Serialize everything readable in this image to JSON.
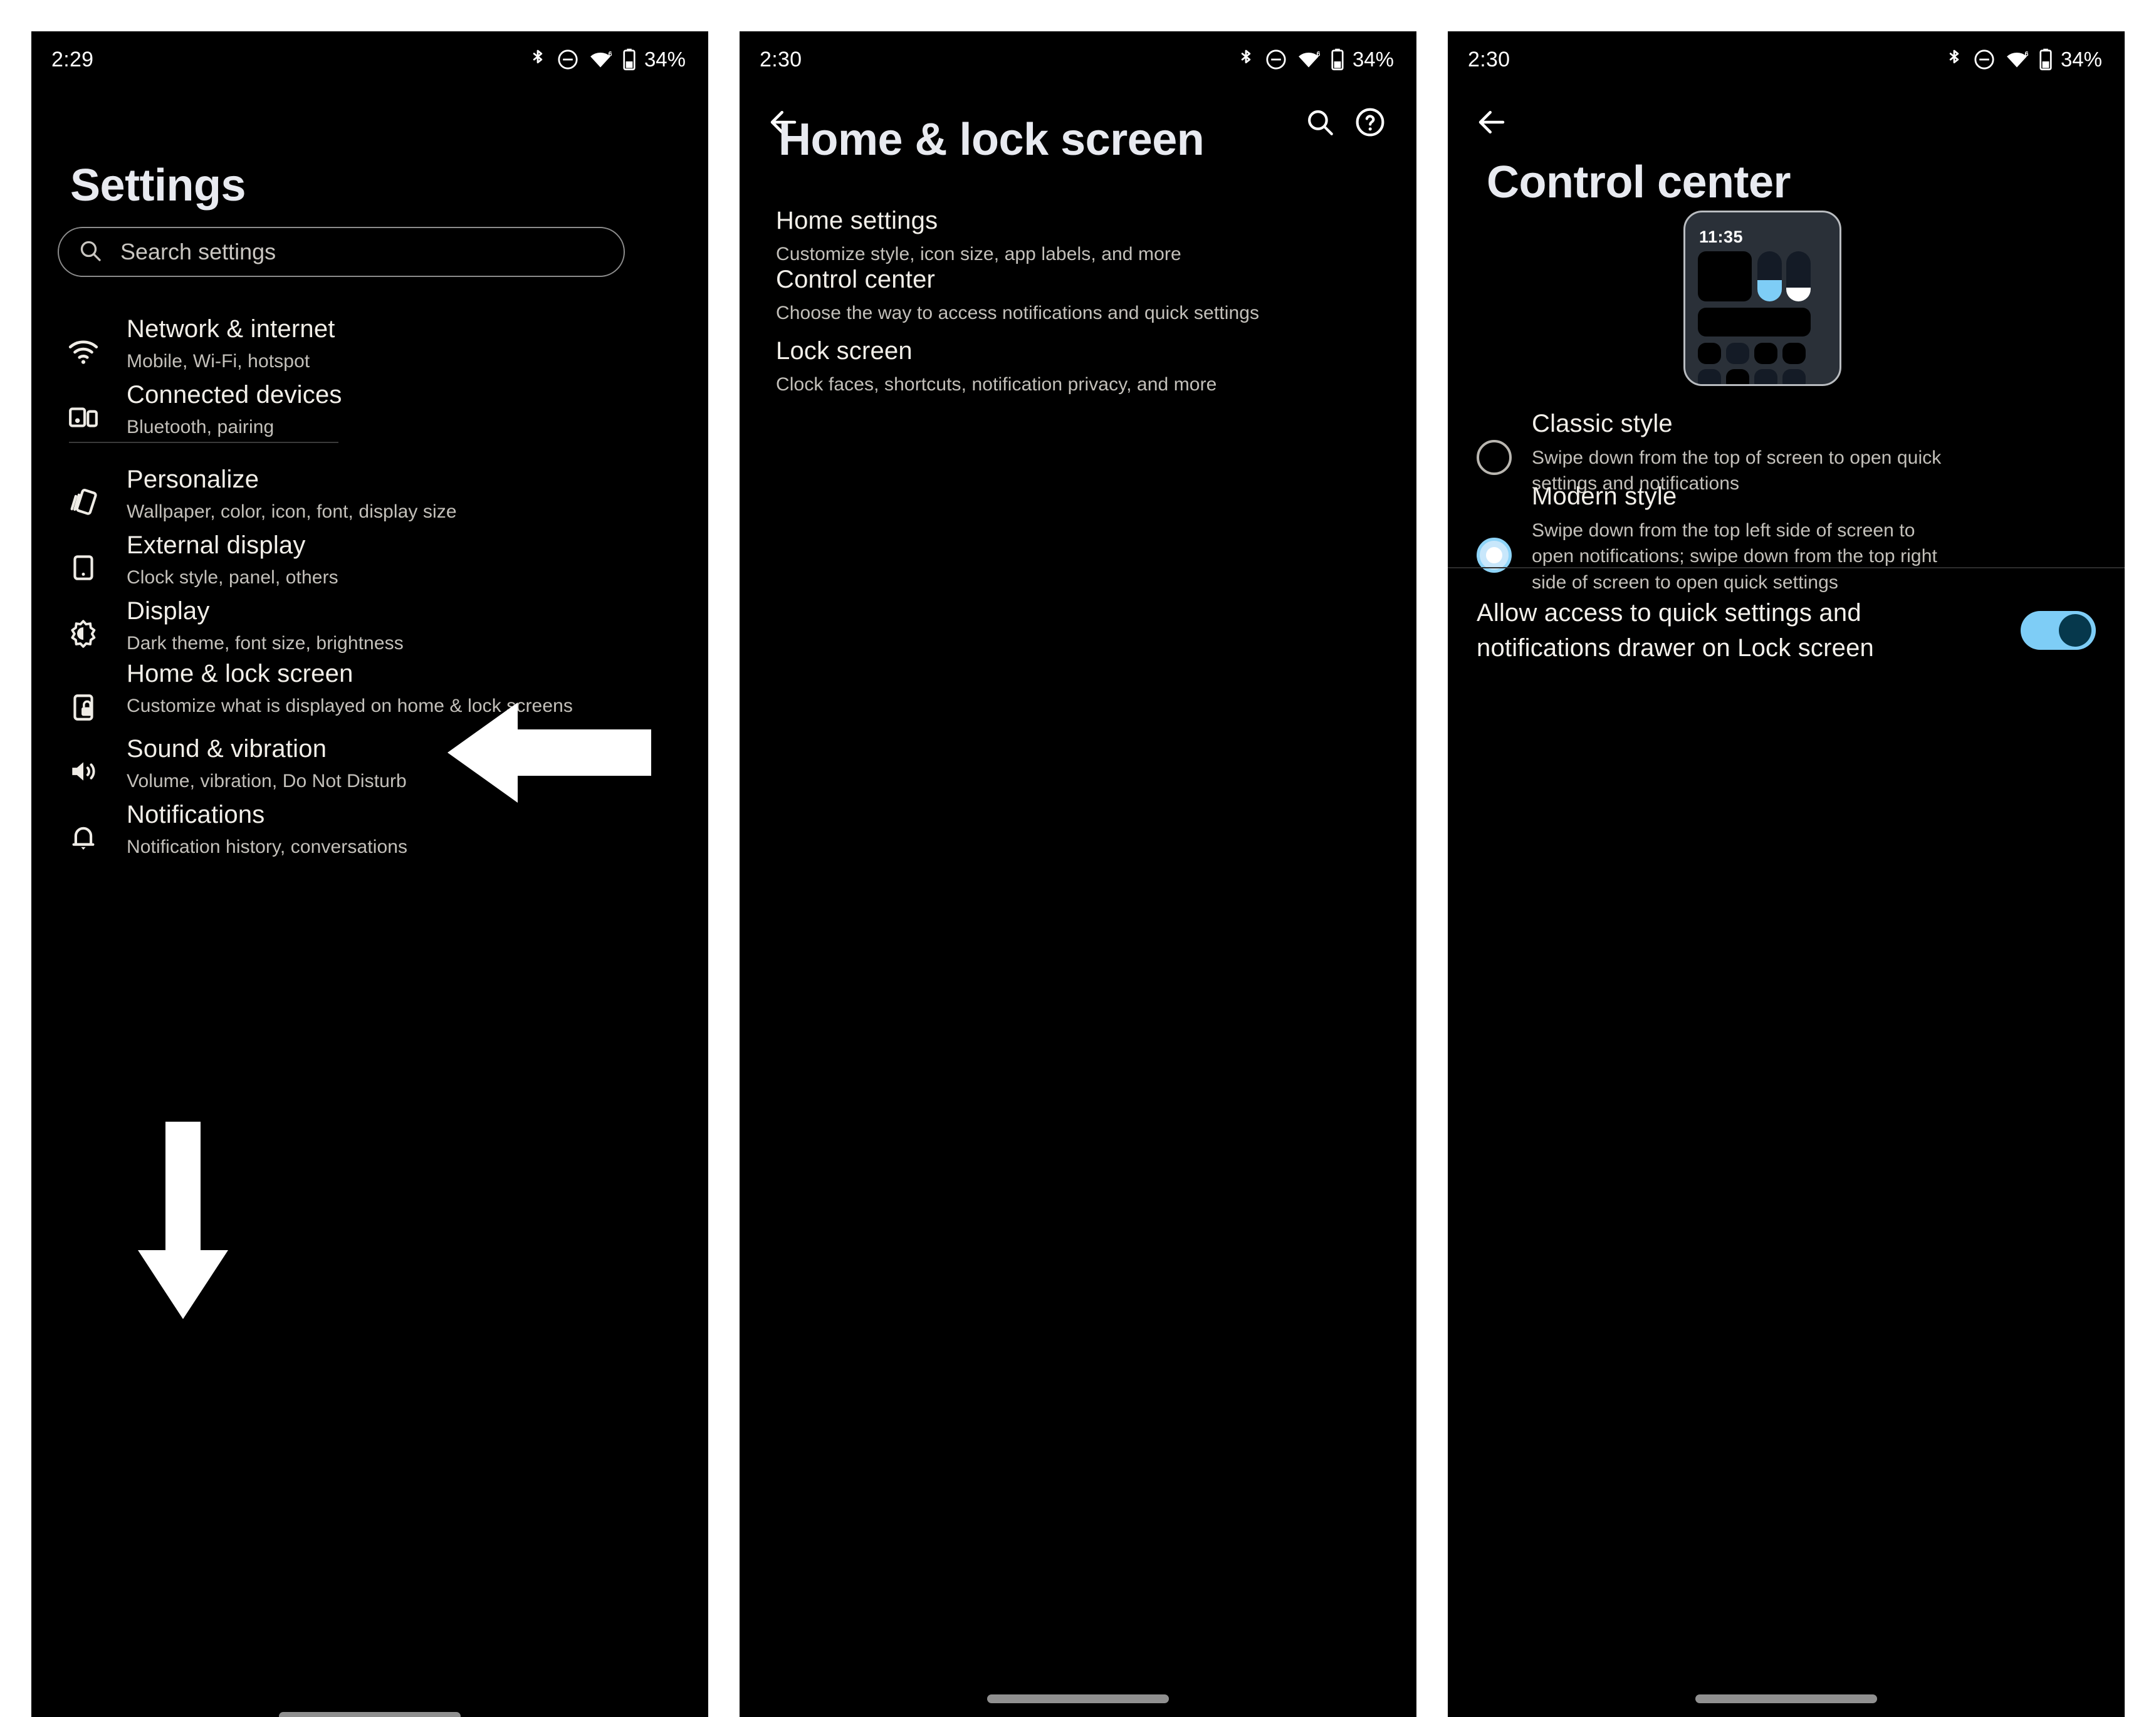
{
  "meta": {
    "accent_blue": "#7ecdf6",
    "accent_blue_dark": "#06384c",
    "background": "#000000",
    "title_color": "#e8eaf0"
  },
  "status_bar": {
    "panel1_time": "2:29",
    "panel2_time": "2:30",
    "panel3_time": "2:30",
    "battery": "34%",
    "icons": [
      "bluetooth-icon",
      "do-not-disturb-icon",
      "wifi-icon",
      "battery-icon"
    ],
    "wifi_label": "6"
  },
  "panel1": {
    "title": "Settings",
    "search": {
      "placeholder": "Search settings",
      "icon": "search-icon"
    },
    "items": [
      {
        "icon": "wifi-icon",
        "title": "Network & internet",
        "subtitle": "Mobile, Wi-Fi, hotspot"
      },
      {
        "icon": "devices-icon",
        "title": "Connected devices",
        "subtitle": "Bluetooth, pairing"
      },
      {
        "icon": "personalize-icon",
        "title": "Personalize",
        "subtitle": "Wallpaper, color, icon, font, display size"
      },
      {
        "icon": "external-display-icon",
        "title": "External display",
        "subtitle": "Clock style, panel, others"
      },
      {
        "icon": "brightness-icon",
        "title": "Display",
        "subtitle": "Dark theme, font size, brightness"
      },
      {
        "icon": "lock-screen-icon",
        "title": "Home & lock screen",
        "subtitle": "Customize what is displayed on home & lock screens"
      },
      {
        "icon": "volume-icon",
        "title": "Sound & vibration",
        "subtitle": "Volume, vibration, Do Not Disturb"
      },
      {
        "icon": "bell-icon",
        "title": "Notifications",
        "subtitle": "Notification history, conversations"
      }
    ]
  },
  "panel2": {
    "title": "Home & lock screen",
    "back_icon": "back-arrow-icon",
    "search_icon": "search-icon",
    "help_icon": "help-circle-icon",
    "items": [
      {
        "title": "Home settings",
        "subtitle": "Customize style, icon size, app labels, and more"
      },
      {
        "title": "Control center",
        "subtitle": "Choose the way to access notifications and quick settings"
      },
      {
        "title": "Lock screen",
        "subtitle": "Clock faces, shortcuts, notification privacy, and more"
      }
    ]
  },
  "panel3": {
    "title": "Control center",
    "back_icon": "back-arrow-icon",
    "preview": {
      "clock": "11:35"
    },
    "options": [
      {
        "title": "Classic style",
        "subtitle": "Swipe down from the top of screen to open quick settings and notifications",
        "selected": false
      },
      {
        "title": "Modern style",
        "subtitle": "Swipe down from the top left side of screen to open notifications; swipe down from the top right side of screen to open quick settings",
        "selected": true
      }
    ],
    "toggle": {
      "label": "Allow access to quick settings and notifications drawer on Lock screen",
      "on": true
    }
  },
  "annotations": [
    {
      "name": "down-arrow-annotation",
      "direction": "down"
    },
    {
      "name": "left-arrow-annotation",
      "direction": "left"
    }
  ]
}
